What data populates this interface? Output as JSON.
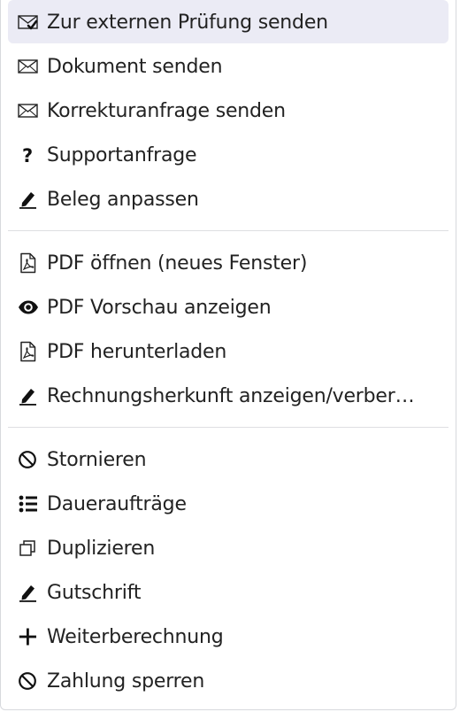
{
  "menu": {
    "groups": [
      {
        "items": [
          {
            "label": "Zur externen Prüfung senden",
            "icon": "envelope-check-icon",
            "highlighted": true
          },
          {
            "label": "Dokument senden",
            "icon": "envelope-icon"
          },
          {
            "label": "Korrekturanfrage senden",
            "icon": "envelope-icon"
          },
          {
            "label": "Supportanfrage",
            "icon": "question-icon"
          },
          {
            "label": "Beleg anpassen",
            "icon": "pencil-icon"
          }
        ]
      },
      {
        "items": [
          {
            "label": "PDF öffnen (neues Fenster)",
            "icon": "pdf-file-icon"
          },
          {
            "label": "PDF Vorschau anzeigen",
            "icon": "eye-icon"
          },
          {
            "label": "PDF herunterladen",
            "icon": "pdf-file-icon"
          },
          {
            "label": "Rechnungsherkunft anzeigen/verber…",
            "icon": "pencil-icon"
          }
        ]
      },
      {
        "items": [
          {
            "label": "Stornieren",
            "icon": "ban-icon"
          },
          {
            "label": "Daueraufträge",
            "icon": "list-icon"
          },
          {
            "label": "Duplizieren",
            "icon": "duplicate-icon"
          },
          {
            "label": "Gutschrift",
            "icon": "pencil-icon"
          },
          {
            "label": "Weiterberechnung",
            "icon": "plus-icon"
          },
          {
            "label": "Zahlung sperren",
            "icon": "ban-icon"
          }
        ]
      }
    ]
  },
  "colors": {
    "highlight": "#ebebf5",
    "text": "#222222",
    "divider": "#dedfe2"
  }
}
